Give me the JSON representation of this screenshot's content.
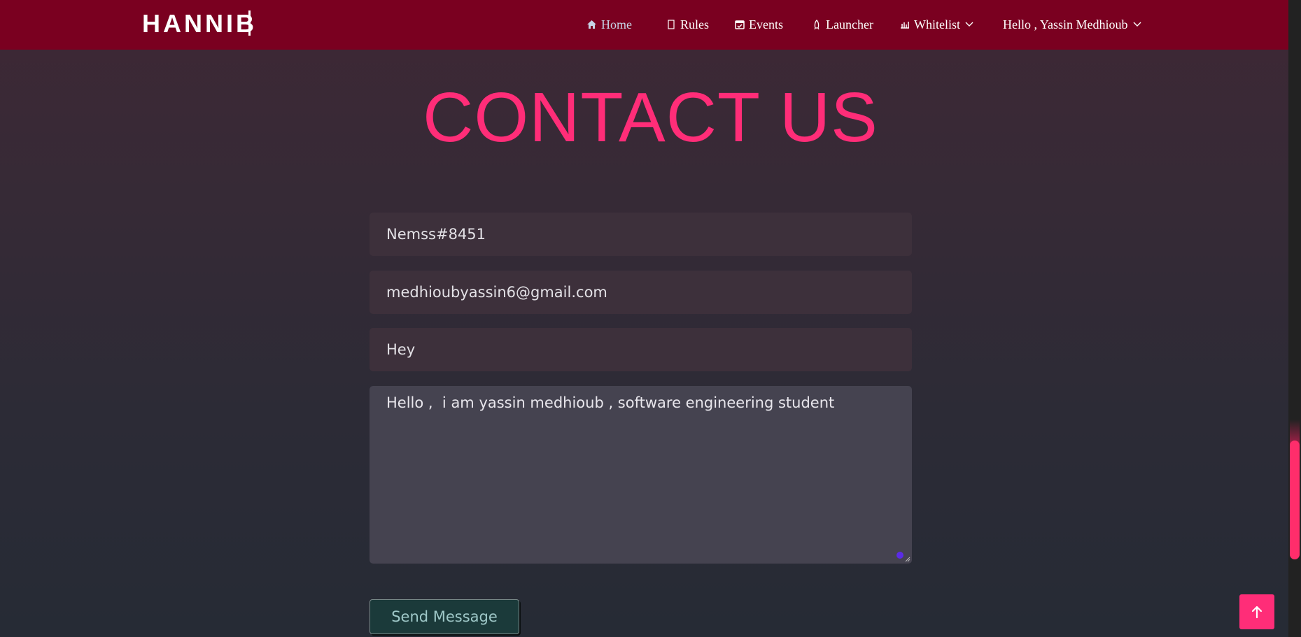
{
  "brand": {
    "name": "HANNIB"
  },
  "nav": [
    {
      "label": "Home",
      "icon": "home-icon",
      "active": true
    },
    {
      "label": "Rules",
      "icon": "rules-icon",
      "active": false
    },
    {
      "label": "Events",
      "icon": "calendar-check-icon",
      "active": false
    },
    {
      "label": "Launcher",
      "icon": "launcher-icon",
      "active": false
    },
    {
      "label": "Whitelist",
      "icon": "whitelist-icon",
      "active": false,
      "dropdown": true
    },
    {
      "label": "Hello , Yassin Medhioub",
      "dropdown": true
    }
  ],
  "page": {
    "title": "CONTACT US"
  },
  "form": {
    "name_value": "Nemss#8451",
    "email_value": "medhioubyassin6@gmail.com",
    "subject_value": "Hey",
    "message_value": "Hello ,  i am yassin medhioub , software engineering student",
    "send_label": "Send Message"
  },
  "colors": {
    "navbar": "#7a0020",
    "accent": "#ff2d78",
    "field": "#3d303b",
    "send_button": "#1b3a3a"
  }
}
